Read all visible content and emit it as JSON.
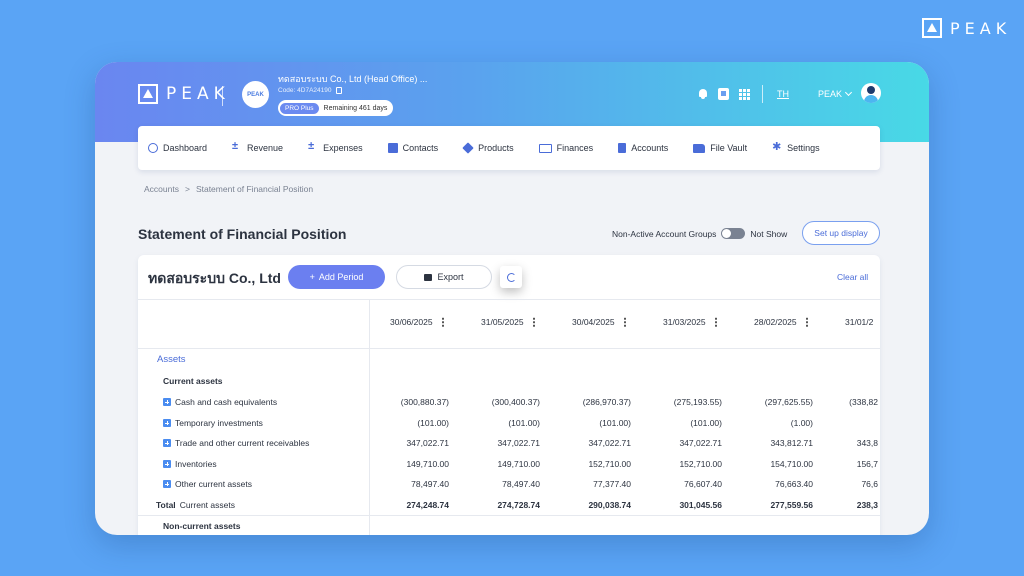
{
  "brand": {
    "logo_word": "PEAK"
  },
  "header": {
    "company_name": "ทดสอบระบบ Co., Ltd (Head Office) ...",
    "company_code": "Code: 4D7A24190",
    "plan": "PRO Plus",
    "remaining": "Remaining 461 days",
    "language": "TH",
    "user": "PEAK"
  },
  "nav": [
    {
      "label": "Dashboard",
      "icon": "dashboard-icon"
    },
    {
      "label": "Revenue",
      "icon": "revenue-icon"
    },
    {
      "label": "Expenses",
      "icon": "expenses-icon"
    },
    {
      "label": "Contacts",
      "icon": "contacts-icon"
    },
    {
      "label": "Products",
      "icon": "products-icon"
    },
    {
      "label": "Finances",
      "icon": "finances-icon"
    },
    {
      "label": "Accounts",
      "icon": "accounts-icon"
    },
    {
      "label": "File Vault",
      "icon": "folder-icon"
    },
    {
      "label": "Settings",
      "icon": "gear-icon"
    }
  ],
  "breadcrumb": {
    "parent": "Accounts",
    "separator": ">",
    "current": "Statement of Financial Position"
  },
  "page": {
    "title": "Statement of Financial Position",
    "non_active_label": "Non-Active Account Groups",
    "toggle_state": "Not Show",
    "setup_display": "Set up display"
  },
  "card": {
    "company": "ทดสอบระบบ Co., Ltd",
    "add_period": "Add Period",
    "export": "Export",
    "clear_all": "Clear all"
  },
  "table": {
    "dates": [
      "30/06/2025",
      "31/05/2025",
      "30/04/2025",
      "31/03/2025",
      "28/02/2025",
      "31/01/2"
    ],
    "section": "Assets",
    "group_current": "Current assets",
    "rows": [
      {
        "label": "Cash and cash equivalents",
        "values": [
          "(300,880.37)",
          "(300,400.37)",
          "(286,970.37)",
          "(275,193.55)",
          "(297,625.55)",
          "(338,82"
        ]
      },
      {
        "label": "Temporary investments",
        "values": [
          "(101.00)",
          "(101.00)",
          "(101.00)",
          "(101.00)",
          "(1.00)",
          ""
        ]
      },
      {
        "label": "Trade and other current receivables",
        "values": [
          "347,022.71",
          "347,022.71",
          "347,022.71",
          "347,022.71",
          "343,812.71",
          "343,8"
        ]
      },
      {
        "label": "Inventories",
        "values": [
          "149,710.00",
          "149,710.00",
          "152,710.00",
          "152,710.00",
          "154,710.00",
          "156,7"
        ]
      },
      {
        "label": "Other current assets",
        "values": [
          "78,497.40",
          "78,497.40",
          "77,377.40",
          "76,607.40",
          "76,663.40",
          "76,6"
        ]
      }
    ],
    "total": {
      "prefix": "Total",
      "label": "Current assets",
      "values": [
        "274,248.74",
        "274,728.74",
        "290,038.74",
        "301,045.56",
        "277,559.56",
        "238,3"
      ]
    },
    "group_noncurrent": "Non-current assets"
  }
}
